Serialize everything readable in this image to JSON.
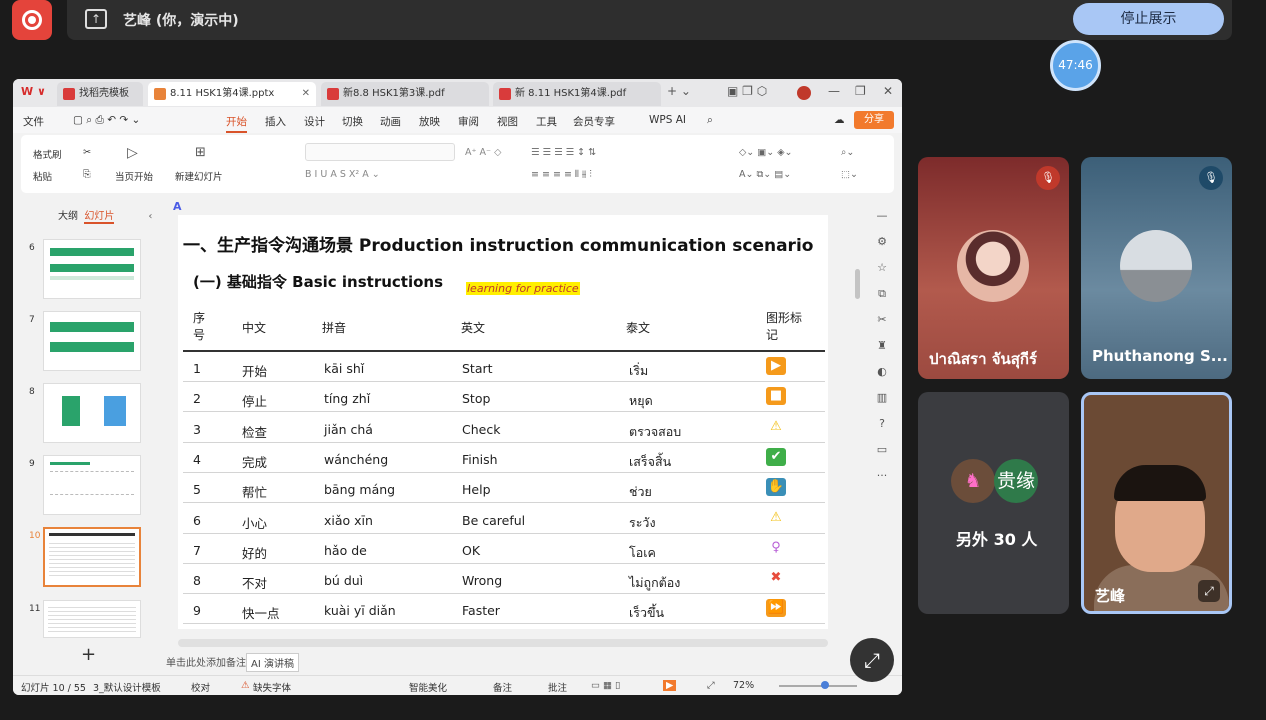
{
  "meeting": {
    "presenter": "艺峰 (你，演示中)",
    "stop_label": "停止展示",
    "timer": "47:46"
  },
  "wps": {
    "tabs": [
      {
        "label": "找稻壳模板",
        "color": "#d93b3b"
      },
      {
        "label": "8.11 HSK1第4课.pptx",
        "color": "#e8833a"
      },
      {
        "label": "新8.8 HSK1第3课.pdf",
        "color": "#d93b3b"
      },
      {
        "label": "新 8.11 HSK1第4课.pdf",
        "color": "#d93b3b"
      }
    ],
    "menus": [
      "文件",
      "开始",
      "插入",
      "设计",
      "切换",
      "动画",
      "放映",
      "审阅",
      "视图",
      "工具",
      "会员专享",
      "WPS AI"
    ],
    "active_menu": "开始",
    "share_label": "分享",
    "ribbon": {
      "format_painter": "格式刷",
      "paste": "粘贴",
      "from_current": "当页开始",
      "new_slide": "新建幻灯片"
    },
    "panel_tabs": {
      "outline": "大纲",
      "slides": "幻灯片"
    },
    "thumbs": [
      "6",
      "7",
      "8",
      "9",
      "10",
      "11"
    ],
    "selected_thumb": "10",
    "notes_placeholder": "单击此处添加备注",
    "ai_notes": "AI 演讲稿",
    "status": {
      "slide_count": "幻灯片 10 / 55",
      "template": "3_默认设计模板",
      "proof": "校对",
      "missing_font": "缺失字体",
      "beautify": "智能美化",
      "notes": "备注",
      "comments": "批注",
      "zoom": "72%"
    }
  },
  "slide": {
    "title": "一、生产指令沟通场景 Production instruction communication scenario",
    "subtitle": "(一) 基础指令 Basic instructions",
    "highlight": "learning for practice",
    "headers": {
      "no": "序号",
      "zh": "中文",
      "py": "拼音",
      "en": "英文",
      "th": "泰文",
      "sym": "图形标记"
    },
    "rows": [
      {
        "no": "1",
        "zh": "开始",
        "py": "kāi shǐ",
        "en": "Start",
        "th": "เริ่ม",
        "icon": "play-icon",
        "glyph": "▶",
        "color": "#f59a1b"
      },
      {
        "no": "2",
        "zh": "停止",
        "py": "tíng zhǐ",
        "en": "Stop",
        "th": "หยุด",
        "icon": "stop-icon",
        "glyph": "■",
        "color": "#f59a1b"
      },
      {
        "no": "3",
        "zh": "检查",
        "py": "jiǎn chá",
        "en": "Check",
        "th": "ตรวจสอบ",
        "icon": "warning-icon",
        "glyph": "⚠",
        "color": "#f2c11a"
      },
      {
        "no": "4",
        "zh": "完成",
        "py": "wánchéng",
        "en": "Finish",
        "th": "เสร็จสิ้น",
        "icon": "check-icon",
        "glyph": "✔",
        "color": "#3fae49"
      },
      {
        "no": "5",
        "zh": "帮忙",
        "py": "bāng máng",
        "en": "Help",
        "th": "ช่วย",
        "icon": "help-icon",
        "glyph": "✋",
        "color": "#3a8fb7"
      },
      {
        "no": "6",
        "zh": "小心",
        "py": "xiǎo xīn",
        "en": "Be careful",
        "th": "ระวัง",
        "icon": "warning-icon",
        "glyph": "⚠",
        "color": "#f2c11a"
      },
      {
        "no": "7",
        "zh": "好的",
        "py": "hǎo de",
        "en": "OK",
        "th": "โอเค",
        "icon": "female-sign-icon",
        "glyph": "♀",
        "color": "#b85fd6"
      },
      {
        "no": "8",
        "zh": "不对",
        "py": "bú duì",
        "en": "Wrong",
        "th": "ไม่ถูกต้อง",
        "icon": "cross-icon",
        "glyph": "✖",
        "color": "#e74c3c"
      },
      {
        "no": "9",
        "zh": "快一点",
        "py": "kuài yī diǎn",
        "en": "Faster",
        "th": "เร็วขึ้น",
        "icon": "fast-forward-icon",
        "glyph": "⏩",
        "color": "#f59a1b"
      }
    ]
  },
  "participants": [
    {
      "name": "ปาณิสรา จันสุกีร์",
      "muted": true
    },
    {
      "name": "Phuthanong S...",
      "muted": true
    },
    {
      "others_label": "另外 30 人",
      "badge": "贵缘"
    },
    {
      "name": "艺峰"
    }
  ]
}
